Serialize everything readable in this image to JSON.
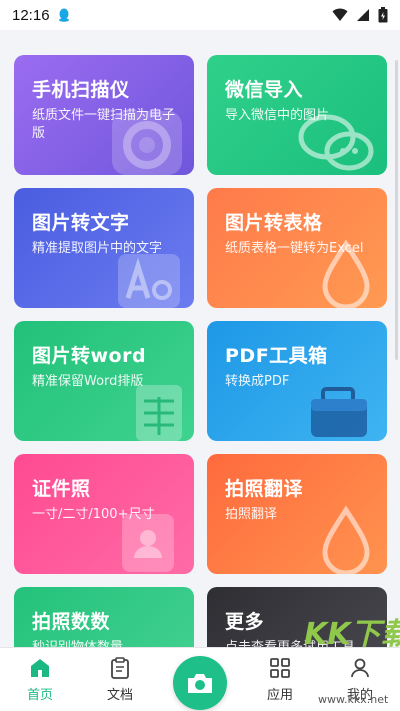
{
  "status_bar": {
    "time": "12:16",
    "icons": [
      "qq-icon",
      "wifi-icon",
      "signal-icon",
      "battery-icon"
    ]
  },
  "cards": [
    {
      "id": "scan",
      "title": "手机扫描仪",
      "desc": "纸质文件一键扫描为电子版",
      "color": "#7e5ee6"
    },
    {
      "id": "wechat",
      "title": "微信导入",
      "desc": "导入微信中的图片",
      "color": "#22c584"
    },
    {
      "id": "ocr",
      "title": "图片转文字",
      "desc": "精准提取图片中的文字",
      "color": "#5666e6"
    },
    {
      "id": "table",
      "title": "图片转表格",
      "desc": "纸质表格一键转为Excel",
      "color": "#ff8a4c"
    },
    {
      "id": "word",
      "title": "图片转word",
      "desc": "精准保留Word排版",
      "color": "#2fca85"
    },
    {
      "id": "pdf",
      "title": "PDF工具箱",
      "desc": "转换成PDF",
      "color": "#2aa6ec"
    },
    {
      "id": "id_photo",
      "title": "证件照",
      "desc": "一寸/二寸/100+尺寸",
      "color": "#ff5a9c"
    },
    {
      "id": "translate",
      "title": "拍照翻译",
      "desc": "拍照翻译",
      "color": "#ff7e46"
    },
    {
      "id": "count",
      "title": "拍照数数",
      "desc": "秒识别物体数量",
      "color": "#33c985"
    },
    {
      "id": "more",
      "title": "更多",
      "desc": "点击查看更多试用工具",
      "color": "#3a3a40"
    }
  ],
  "bottom_nav": {
    "home": "首页",
    "docs": "文档",
    "apps": "应用",
    "me": "我的",
    "active_color": "#1db984",
    "camera_color": "#1fbf8a"
  },
  "watermark": {
    "letters": "KK下载",
    "url": "www.kkx.net"
  }
}
